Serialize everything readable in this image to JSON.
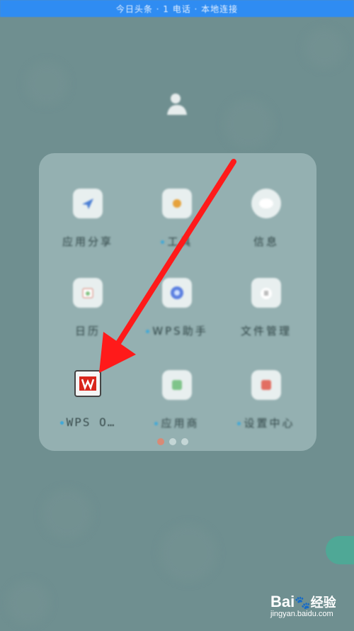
{
  "status_banner": {
    "text": "今日头条  ·  1 电话  ·  本地连接"
  },
  "folder": {
    "apps": [
      {
        "label": "应用分享",
        "icon": "send-app-icon",
        "has_dot": false
      },
      {
        "label": "工具",
        "icon": "sun-app-icon",
        "has_dot": true
      },
      {
        "label": "信息",
        "icon": "message-app-icon",
        "has_dot": false
      },
      {
        "label": "日历",
        "icon": "calendar-app-icon",
        "has_dot": false
      },
      {
        "label": "WPS助手",
        "icon": "browser-app-icon",
        "has_dot": true
      },
      {
        "label": "文件管理",
        "icon": "files-app-icon",
        "has_dot": false
      },
      {
        "label": "WPS O…",
        "icon": "wps-office-icon",
        "has_dot": true
      },
      {
        "label": "应用商",
        "icon": "store-app-icon",
        "has_dot": true
      },
      {
        "label": "设置中心",
        "icon": "settings-app-icon",
        "has_dot": true
      }
    ],
    "page_indicator": {
      "count": 3,
      "active_index": 0
    }
  },
  "annotation": {
    "type": "red-arrow",
    "target": "wps-office-icon",
    "color": "#ff1a1a"
  },
  "watermark": {
    "brand": "Bai",
    "brand_cn": "经验",
    "url": "jingyan.baidu.com"
  },
  "colors": {
    "background": "#6f8f90",
    "folder": "#9bb6b7",
    "banner": "#2f8cf2",
    "wps_red": "#d9261c"
  }
}
